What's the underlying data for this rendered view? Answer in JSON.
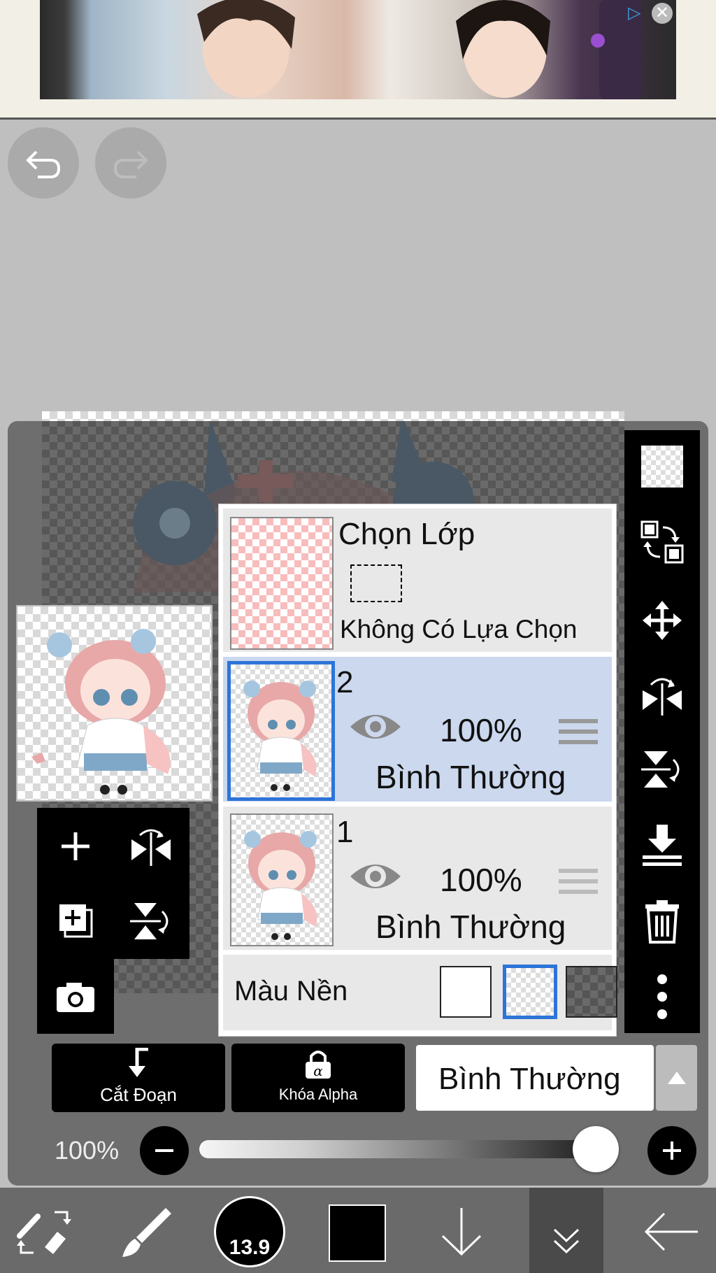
{
  "ad": {
    "banner": "advertisement banner"
  },
  "layers_panel": {
    "selection_layer": {
      "title": "Chọn Lớp",
      "status": "Không Có Lựa Chọn"
    },
    "layers": [
      {
        "name": "2",
        "opacity": "100%",
        "blend": "Bình Thường",
        "selected": true
      },
      {
        "name": "1",
        "opacity": "100%",
        "blend": "Bình Thường",
        "selected": false
      }
    ],
    "background": {
      "label": "Màu Nền"
    }
  },
  "bottom_bar": {
    "clip_label": "Cắt Đoạn",
    "alpha_lock_label": "Khóa Alpha",
    "blend_mode": "Bình Thường",
    "opacity_label": "100%",
    "opacity_value": 1.0
  },
  "toolbar": {
    "brush_size": "13.9",
    "color": "#000000"
  },
  "colors": {
    "selected_layer_bg": "#cbd8ee",
    "accent": "#2d74d8"
  }
}
